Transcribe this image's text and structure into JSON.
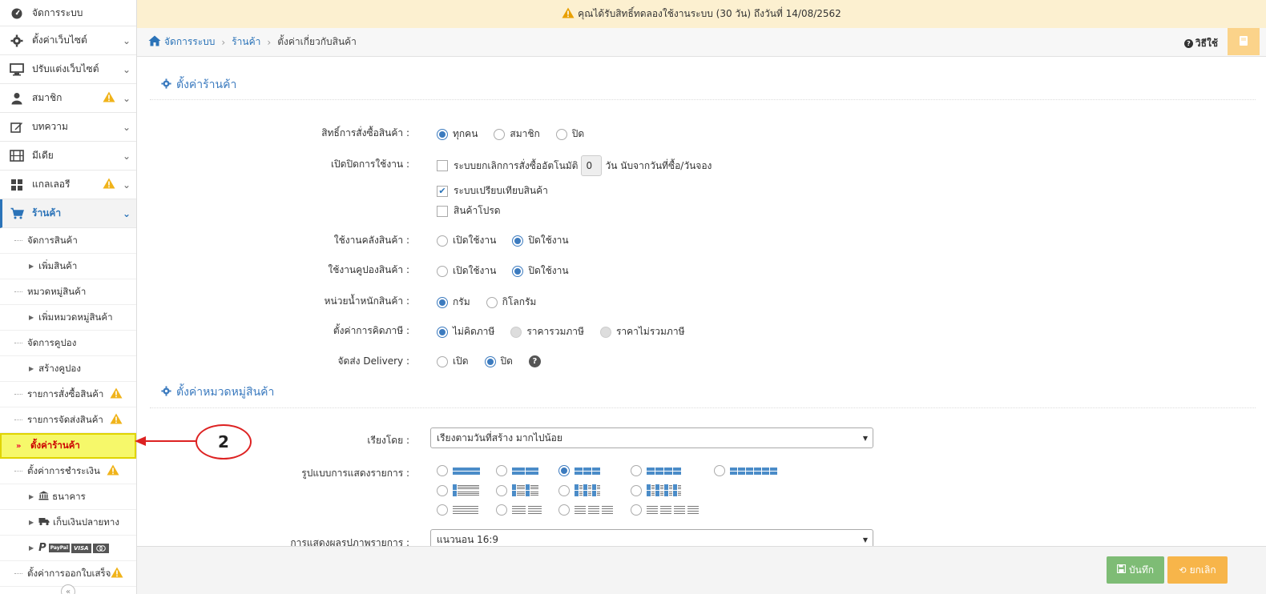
{
  "banner": {
    "text": "คุณได้รับสิทธิ์ทดลองใช้งานระบบ (30 วัน) ถึงวันที่ 14/08/2562"
  },
  "sidebar": {
    "items": [
      {
        "label": "จัดการระบบ",
        "icon": "dashboard-icon"
      },
      {
        "label": "ตั้งค่าเว็บไซต์",
        "icon": "gear-icon"
      },
      {
        "label": "ปรับแต่งเว็บไซต์",
        "icon": "monitor-icon"
      },
      {
        "label": "สมาชิก",
        "icon": "user-icon"
      },
      {
        "label": "บทความ",
        "icon": "edit-icon"
      },
      {
        "label": "มีเดีย",
        "icon": "film-icon"
      },
      {
        "label": "แกลเลอรี",
        "icon": "grid-icon"
      },
      {
        "label": "ร้านค้า",
        "icon": "cart-icon"
      }
    ],
    "shop_sub": [
      "จัดการสินค้า",
      "เพิ่มสินค้า",
      "หมวดหมู่สินค้า",
      "เพิ่มหมวดหมู่สินค้า",
      "จัดการคูปอง",
      "สร้างคูปอง",
      "รายการสั่งซื้อสินค้า",
      "รายการจัดส่งสินค้า",
      "ตั้งค่าร้านค้า",
      "ตั้งค่าการชำระเงิน",
      "ธนาคาร",
      "เก็บเงินปลายทาง",
      "ตั้งค่าการออกใบเสร็จ"
    ],
    "payment_logos": [
      "P",
      "PayPal",
      "VISA"
    ]
  },
  "breadcrumb": {
    "home": "จัดการระบบ",
    "mid": "ร้านค้า",
    "current": "ตั้งค่าเกี่ยวกับสินค้า",
    "howto": "วิธีใช้"
  },
  "section1": {
    "title": "ตั้งค่าร้านค้า",
    "order_rights": {
      "label": "สิทธิ์การสั่งซื้อสินค้า :",
      "options": [
        "ทุกคน",
        "สมาชิก",
        "ปิด"
      ]
    },
    "features": {
      "label": "เปิดปิดการใช้งาน :",
      "auto_cancel_prefix": "ระบบยกเลิกการสั่งซื้ออัตโนมัติ",
      "auto_cancel_days": "0",
      "auto_cancel_suffix": "วัน นับจากวันที่ซื้อ/วันจอง",
      "compare": "ระบบเปรียบเทียบสินค้า",
      "favorite": "สินค้าโปรด"
    },
    "stock": {
      "label": "ใช้งานคลังสินค้า :",
      "on": "เปิดใช้งาน",
      "off": "ปิดใช้งาน"
    },
    "coupon": {
      "label": "ใช้งานคูปองสินค้า :",
      "on": "เปิดใช้งาน",
      "off": "ปิดใช้งาน"
    },
    "weight": {
      "label": "หน่วยน้ำหนักสินค้า :",
      "options": [
        "กรัม",
        "กิโลกรัม"
      ]
    },
    "tax": {
      "label": "ตั้งค่าการคิดภาษี :",
      "options": [
        "ไม่คิดภาษี",
        "ราคารวมภาษี",
        "ราคาไม่รวมภาษี"
      ]
    },
    "delivery": {
      "label": "จัดส่ง Delivery :",
      "options": [
        "เปิด",
        "ปิด"
      ]
    }
  },
  "section2": {
    "title": "ตั้งค่าหมวดหมู่สินค้า",
    "sort": {
      "label": "เรียงโดย :",
      "value": "เรียงตามวันที่สร้าง มากไปน้อย"
    },
    "layout": {
      "label": "รูปแบบการแสดงรายการ :"
    },
    "image_ratio": {
      "label": "การแสดงผลรูปภาพรายการ :",
      "value": "แนวนอน 16:9"
    }
  },
  "actions": {
    "save": "บันทึก",
    "cancel": "ยกเลิก"
  },
  "annotation": {
    "number": "2"
  },
  "colors": {
    "accent": "#3c7bbf",
    "highlight": "#f6f86a",
    "annotation": "#d22222",
    "save": "#7ebc75",
    "cancel": "#f7b54a"
  }
}
